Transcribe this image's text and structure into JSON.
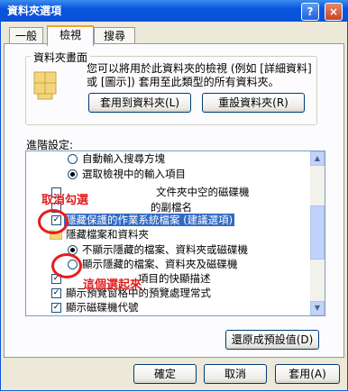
{
  "window": {
    "title": "資料夾選項",
    "help": "?",
    "close": "×"
  },
  "tabs": [
    {
      "label": "一般"
    },
    {
      "label": "檢視"
    },
    {
      "label": "搜尋"
    }
  ],
  "folder_views": {
    "group_label": "資料夾畫面",
    "description": "您可以將用於此資料夾的檢視 (例如 [詳細資料] 或 [圖示]) 套用至此類型的所有資料夾。",
    "apply_button": "套用到資料夾(L)",
    "reset_button": "重設資料夾(R)"
  },
  "advanced": {
    "label": "進階設定:",
    "items": [
      {
        "type": "radio",
        "label": "自動輸入搜尋方塊",
        "checked": false
      },
      {
        "type": "radio",
        "label": "選取檢視中的輸入項目",
        "checked": true
      },
      {
        "type": "partial",
        "label": "文件夾中空的磁碟機"
      },
      {
        "type": "partial",
        "label": "的副檔名"
      },
      {
        "type": "checkbox",
        "label": "隱藏保護的作業系統檔案 (建議選項)",
        "checked": true,
        "selected": true
      },
      {
        "type": "folder",
        "label": "隱藏檔案和資料夾"
      },
      {
        "type": "radio",
        "label": "不顯示隱藏的檔案、資料夾或磁碟機",
        "checked": false
      },
      {
        "type": "radio",
        "label": "顯示隱藏的檔案、資料夾及磁碟機",
        "checked": false
      },
      {
        "type": "checkbox",
        "label": "項目的快顯描述",
        "checked": true
      },
      {
        "type": "checkbox",
        "label": "顯示預覽窗格中的預覽處理常式",
        "checked": true
      },
      {
        "type": "checkbox",
        "label": "顯示磁碟機代號",
        "checked": true
      }
    ],
    "restore_button": "還原成預設值(D)"
  },
  "annotations": {
    "uncheck": "取消勾選",
    "select_this": "這個選起來"
  },
  "footer": {
    "ok": "確定",
    "cancel": "取消",
    "apply": "套用(A)"
  },
  "colors": {
    "title_bar": "#0a55e0",
    "selection": "#316ac5",
    "annotation": "#e02020",
    "tab_highlight": "#f5a32a"
  }
}
